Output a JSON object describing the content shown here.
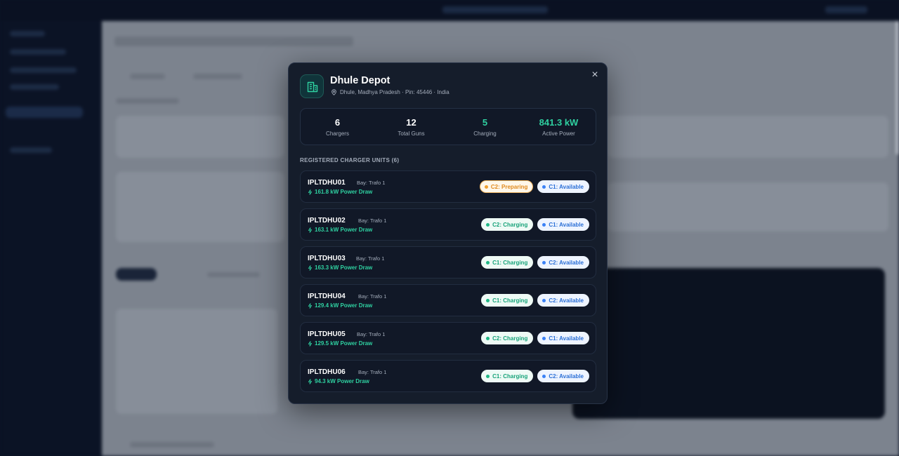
{
  "modal": {
    "title": "Dhule Depot",
    "location": "Dhule, Madhya Pradesh · Pin: 45446 · India",
    "close_icon": "×",
    "stats": [
      {
        "value": "6",
        "label": "Chargers"
      },
      {
        "value": "12",
        "label": "Total Guns"
      },
      {
        "value": "5",
        "label": "Charging"
      },
      {
        "value": "841.3 kW",
        "label": "Active Power"
      }
    ],
    "section_title": "REGISTERED CHARGER UNITS (6)",
    "units": [
      {
        "id": "IPLTDHU01",
        "bay": "Bay: Trafo 1",
        "power": "161.8 kW Power Draw",
        "badges": [
          {
            "label": "C2: Preparing",
            "status": "prep"
          },
          {
            "label": "C1: Available",
            "status": "av"
          }
        ]
      },
      {
        "id": "IPLTDHU02",
        "bay": "Bay: Trafo 1",
        "power": "163.1 kW Power Draw",
        "badges": [
          {
            "label": "C2: Charging",
            "status": "chg"
          },
          {
            "label": "C1: Available",
            "status": "av"
          }
        ]
      },
      {
        "id": "IPLTDHU03",
        "bay": "Bay: Trafo 1",
        "power": "163.3 kW Power Draw",
        "badges": [
          {
            "label": "C1: Charging",
            "status": "chg"
          },
          {
            "label": "C2: Available",
            "status": "av"
          }
        ]
      },
      {
        "id": "IPLTDHU04",
        "bay": "Bay: Trafo 1",
        "power": "129.4 kW Power Draw",
        "badges": [
          {
            "label": "C1: Charging",
            "status": "chg"
          },
          {
            "label": "C2: Available",
            "status": "av"
          }
        ]
      },
      {
        "id": "IPLTDHU05",
        "bay": "Bay: Trafo 1",
        "power": "129.5 kW Power Draw",
        "badges": [
          {
            "label": "C2: Charging",
            "status": "chg"
          },
          {
            "label": "C1: Available",
            "status": "av"
          }
        ]
      },
      {
        "id": "IPLTDHU06",
        "bay": "Bay: Trafo 1",
        "power": "94.3 kW Power Draw",
        "badges": [
          {
            "label": "C1: Charging",
            "status": "chg"
          },
          {
            "label": "C2: Available",
            "status": "av"
          }
        ]
      }
    ]
  },
  "colors": {
    "accent_green": "#2fd1a1",
    "preparing": "#e08a1e",
    "available": "#2a6fd6",
    "charging": "#17a37a"
  },
  "icons": {
    "header": "building-icon",
    "location": "map-pin-icon",
    "power": "bolt-icon",
    "close": "close-icon"
  }
}
